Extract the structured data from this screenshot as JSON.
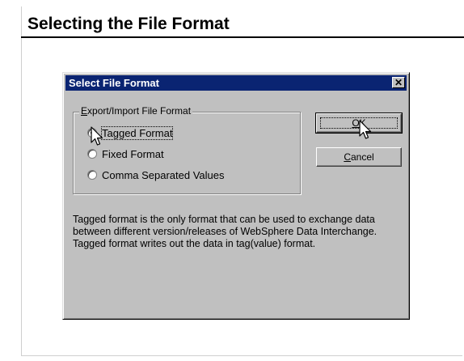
{
  "slide": {
    "title": "Selecting the File Format"
  },
  "dialog": {
    "title": "Select File Format",
    "close_glyph": "✕",
    "group_label_prefix": "",
    "group_label_mnemonic": "E",
    "group_label_rest": "xport/Import File Format",
    "options": [
      {
        "label": "Tagged Format",
        "selected": true
      },
      {
        "label": "Fixed Format",
        "selected": false
      },
      {
        "label": "Comma Separated Values",
        "selected": false
      }
    ],
    "ok": {
      "mnemonic": "O",
      "rest": "K"
    },
    "cancel": {
      "mnemonic": "C",
      "rest": "ancel"
    },
    "description": "Tagged format is the only format that can be used to exchange data between different version/releases of WebSphere Data Interchange.  Tagged format writes out the data in tag(value) format."
  },
  "colors": {
    "titlebar": "#0a2472",
    "dialog_face": "#c0c0c0"
  }
}
